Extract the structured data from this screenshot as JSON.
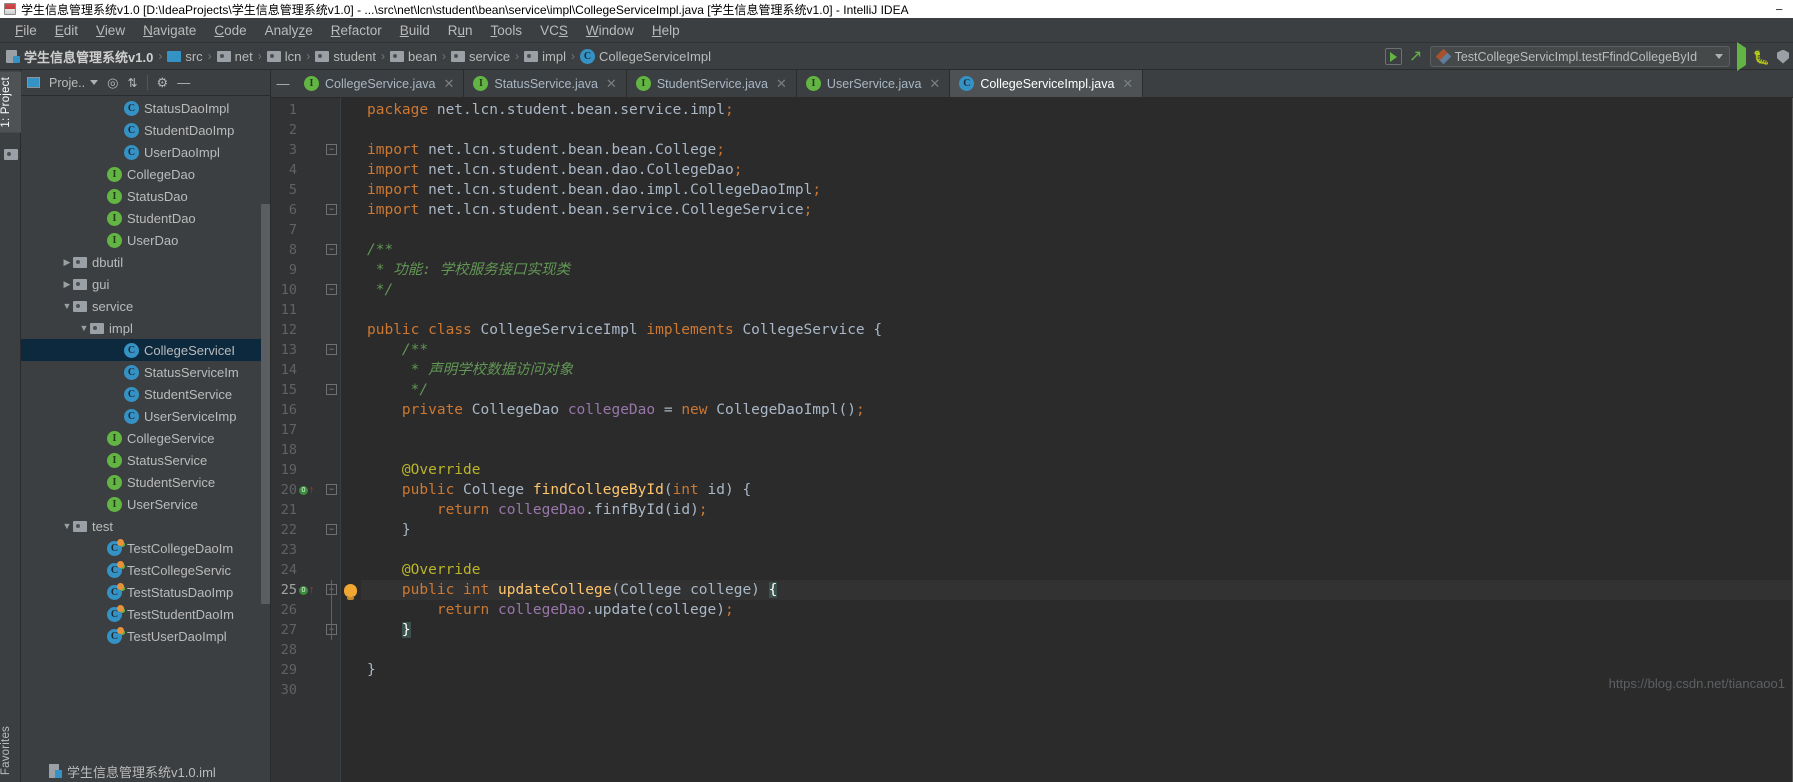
{
  "titlebar": {
    "text": "学生信息管理系统v1.0 [D:\\IdeaProjects\\学生信息管理系统v1.0] - ...\\src\\net\\lcn\\student\\bean\\service\\impl\\CollegeServiceImpl.java [学生信息管理系统v1.0] - IntelliJ IDEA",
    "minimize": "−"
  },
  "menubar": {
    "items": [
      "File",
      "Edit",
      "View",
      "Navigate",
      "Code",
      "Analyze",
      "Refactor",
      "Build",
      "Run",
      "Tools",
      "VCS",
      "Window",
      "Help"
    ]
  },
  "breadcrumb": {
    "items": [
      {
        "label": "学生信息管理系统v1.0",
        "icon": "module-icon",
        "bold": true
      },
      {
        "label": "src",
        "icon": "folder-blue-icon",
        "bold": false
      },
      {
        "label": "net",
        "icon": "folder-icon",
        "bold": false
      },
      {
        "label": "lcn",
        "icon": "folder-icon",
        "bold": false
      },
      {
        "label": "student",
        "icon": "folder-icon",
        "bold": false
      },
      {
        "label": "bean",
        "icon": "folder-icon",
        "bold": false
      },
      {
        "label": "service",
        "icon": "folder-icon",
        "bold": false
      },
      {
        "label": "impl",
        "icon": "folder-icon",
        "bold": false
      },
      {
        "label": "CollegeServiceImpl",
        "icon": "class-icon",
        "bold": false
      }
    ],
    "separator": "›"
  },
  "toolbar": {
    "run_config": "TestCollegeServicImpl.testFfindCollegeById",
    "run_button": "run-icon",
    "debug_button": "debug-icon",
    "coverage_button": "coverage-icon",
    "make_button": "make-project-icon",
    "hammer_button": "build-icon"
  },
  "left_strip": {
    "project_tab": "1: Project",
    "favorites_tab": "Favorites"
  },
  "project_panel": {
    "title": "Proje..",
    "locate_icon": "locate-icon",
    "collapse_icon": "collapse-all-icon",
    "settings_icon": "gear-icon",
    "hide_icon": "hide-icon",
    "tree": [
      {
        "label": "StatusDaoImpl",
        "icon": "class-icon",
        "indent": 5,
        "arrow": "",
        "selected": false
      },
      {
        "label": "StudentDaoImp",
        "icon": "class-icon",
        "indent": 5,
        "arrow": "",
        "selected": false
      },
      {
        "label": "UserDaoImpl",
        "icon": "class-icon",
        "indent": 5,
        "arrow": "",
        "selected": false
      },
      {
        "label": "CollegeDao",
        "icon": "interface-icon",
        "indent": 4,
        "arrow": "",
        "selected": false
      },
      {
        "label": "StatusDao",
        "icon": "interface-icon",
        "indent": 4,
        "arrow": "",
        "selected": false
      },
      {
        "label": "StudentDao",
        "icon": "interface-icon",
        "indent": 4,
        "arrow": "",
        "selected": false
      },
      {
        "label": "UserDao",
        "icon": "interface-icon",
        "indent": 4,
        "arrow": "",
        "selected": false
      },
      {
        "label": "dbutil",
        "icon": "folder-icon",
        "indent": 2,
        "arrow": "▶",
        "selected": false
      },
      {
        "label": "gui",
        "icon": "folder-icon",
        "indent": 2,
        "arrow": "▶",
        "selected": false
      },
      {
        "label": "service",
        "icon": "folder-icon",
        "indent": 2,
        "arrow": "▼",
        "selected": false
      },
      {
        "label": "impl",
        "icon": "folder-icon",
        "indent": 3,
        "arrow": "▼",
        "selected": false
      },
      {
        "label": "CollegeServiceI",
        "icon": "class-icon",
        "indent": 5,
        "arrow": "",
        "selected": true
      },
      {
        "label": "StatusServiceIm",
        "icon": "class-icon",
        "indent": 5,
        "arrow": "",
        "selected": false
      },
      {
        "label": "StudentService",
        "icon": "class-icon",
        "indent": 5,
        "arrow": "",
        "selected": false
      },
      {
        "label": "UserServiceImp",
        "icon": "class-icon",
        "indent": 5,
        "arrow": "",
        "selected": false
      },
      {
        "label": "CollegeService",
        "icon": "interface-icon",
        "indent": 4,
        "arrow": "",
        "selected": false
      },
      {
        "label": "StatusService",
        "icon": "interface-icon",
        "indent": 4,
        "arrow": "",
        "selected": false
      },
      {
        "label": "StudentService",
        "icon": "interface-icon",
        "indent": 4,
        "arrow": "",
        "selected": false
      },
      {
        "label": "UserService",
        "icon": "interface-icon",
        "indent": 4,
        "arrow": "",
        "selected": false
      },
      {
        "label": "test",
        "icon": "folder-icon",
        "indent": 2,
        "arrow": "▼",
        "selected": false
      },
      {
        "label": "TestCollegeDaoIm",
        "icon": "test-class-icon",
        "indent": 4,
        "arrow": "",
        "selected": false
      },
      {
        "label": "TestCollegeServic",
        "icon": "test-class-icon",
        "indent": 4,
        "arrow": "",
        "selected": false
      },
      {
        "label": "TestStatusDaoImp",
        "icon": "test-class-icon",
        "indent": 4,
        "arrow": "",
        "selected": false
      },
      {
        "label": "TestStudentDaoIm",
        "icon": "test-class-icon",
        "indent": 4,
        "arrow": "",
        "selected": false
      },
      {
        "label": "TestUserDaoImpl",
        "icon": "test-class-icon",
        "indent": 4,
        "arrow": "",
        "selected": false
      }
    ],
    "bottom_file": "学生信息管理系统v1.0.iml"
  },
  "editor_tabs": [
    {
      "label": "CollegeService.java",
      "icon": "interface-icon",
      "active": false,
      "close": "✕"
    },
    {
      "label": "StatusService.java",
      "icon": "interface-icon",
      "active": false,
      "close": "✕"
    },
    {
      "label": "StudentService.java",
      "icon": "interface-icon",
      "active": false,
      "close": "✕"
    },
    {
      "label": "UserService.java",
      "icon": "interface-icon",
      "active": false,
      "close": "✕"
    },
    {
      "label": "CollegeServiceImpl.java",
      "icon": "class-icon",
      "active": true,
      "close": "✕"
    }
  ],
  "editor": {
    "lines": [
      {
        "n": 1,
        "text": "package net.lcn.student.bean.service.impl;"
      },
      {
        "n": 2,
        "text": ""
      },
      {
        "n": 3,
        "text": "import net.lcn.student.bean.bean.College;"
      },
      {
        "n": 4,
        "text": "import net.lcn.student.bean.dao.CollegeDao;"
      },
      {
        "n": 5,
        "text": "import net.lcn.student.bean.dao.impl.CollegeDaoImpl;"
      },
      {
        "n": 6,
        "text": "import net.lcn.student.bean.service.CollegeService;"
      },
      {
        "n": 7,
        "text": ""
      },
      {
        "n": 8,
        "text": "/**"
      },
      {
        "n": 9,
        "text": " * 功能: 学校服务接口实现类"
      },
      {
        "n": 10,
        "text": " */"
      },
      {
        "n": 11,
        "text": ""
      },
      {
        "n": 12,
        "text": "public class CollegeServiceImpl implements CollegeService {"
      },
      {
        "n": 13,
        "text": "    /**"
      },
      {
        "n": 14,
        "text": "     * 声明学校数据访问对象"
      },
      {
        "n": 15,
        "text": "     */"
      },
      {
        "n": 16,
        "text": "    private CollegeDao collegeDao = new CollegeDaoImpl();"
      },
      {
        "n": 17,
        "text": ""
      },
      {
        "n": 18,
        "text": ""
      },
      {
        "n": 19,
        "text": "    @Override"
      },
      {
        "n": 20,
        "text": "    public College findCollegeById(int id) {"
      },
      {
        "n": 21,
        "text": "        return collegeDao.finfById(id);"
      },
      {
        "n": 22,
        "text": "    }"
      },
      {
        "n": 23,
        "text": ""
      },
      {
        "n": 24,
        "text": "    @Override"
      },
      {
        "n": 25,
        "text": "    public int updateCollege(College college) {"
      },
      {
        "n": 26,
        "text": "        return collegeDao.update(college);"
      },
      {
        "n": 27,
        "text": "    }"
      },
      {
        "n": 28,
        "text": ""
      },
      {
        "n": 29,
        "text": "}"
      },
      {
        "n": 30,
        "text": ""
      }
    ],
    "current_line": 25,
    "gutter_markers": [
      {
        "line": 20,
        "icon": "override-marker"
      },
      {
        "line": 25,
        "icon": "override-marker"
      }
    ],
    "intention_bulb_line": 25
  },
  "watermark": "https://blog.csdn.net/tiancaoo1",
  "colors": {
    "editor_bg": "#2b2b2b",
    "panel_bg": "#3c3f41",
    "selection": "#0d293e",
    "keyword": "#cc7832",
    "comment": "#629755",
    "annotation": "#bbb529",
    "method": "#ffc66d",
    "field": "#9876aa",
    "text": "#a9b7c6",
    "accent_blue": "#3592c4",
    "accent_green": "#62b543"
  }
}
